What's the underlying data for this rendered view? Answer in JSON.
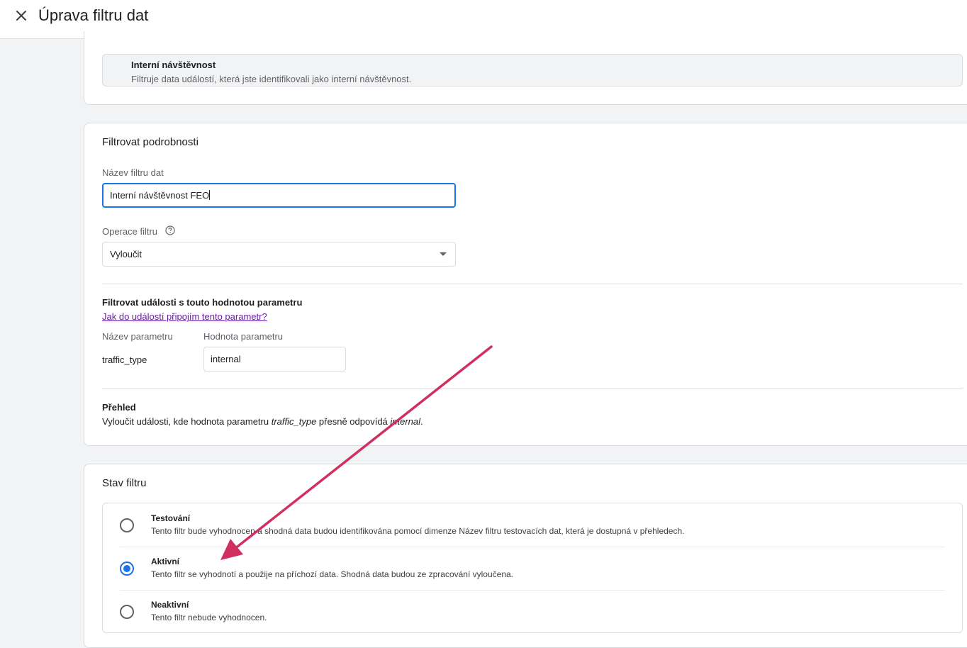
{
  "header": {
    "title": "Úprava filtru dat"
  },
  "filter_type": {
    "title": "Interní návštěvnost",
    "description": "Filtruje data událostí, která jste identifikovali jako interní návštěvnost."
  },
  "details": {
    "heading": "Filtrovat podrobnosti",
    "name_label": "Název filtru dat",
    "name_value": "Interní návštěvnost FEO",
    "operation_label": "Operace filtru",
    "operation_value": "Vyloučit",
    "param_heading": "Filtrovat události s touto hodnotou parametru",
    "param_link": "Jak do událostí připojím tento parametr?",
    "param_name_label": "Název parametru",
    "param_value_label": "Hodnota parametru",
    "param_name_value": "traffic_type",
    "param_value_value": "internal",
    "summary_heading": "Přehled",
    "summary": {
      "part1": "Vyloučit události, kde hodnota parametru ",
      "param": "traffic_type",
      "part2": " přesně odpovídá ",
      "value": "internal",
      "part3": "."
    }
  },
  "status": {
    "heading": "Stav filtru",
    "options": [
      {
        "title": "Testování",
        "description": "Tento filtr bude vyhodnocen a shodná data budou identifikována pomocí dimenze Název filtru testovacích dat, která je dostupná v přehledech.",
        "selected": false
      },
      {
        "title": "Aktivní",
        "description": "Tento filtr se vyhodnotí a použije na příchozí data. Shodná data budou ze zpracování vyloučena.",
        "selected": true
      },
      {
        "title": "Neaktivní",
        "description": "Tento filtr nebude vyhodnocen.",
        "selected": false
      }
    ]
  },
  "colors": {
    "accent": "#1a73e8",
    "link": "#681da8",
    "annotation_arrow": "#d0305f"
  },
  "icons": {
    "close": "close-icon",
    "help": "help-circle-icon",
    "dropdown": "chevron-down-icon"
  }
}
